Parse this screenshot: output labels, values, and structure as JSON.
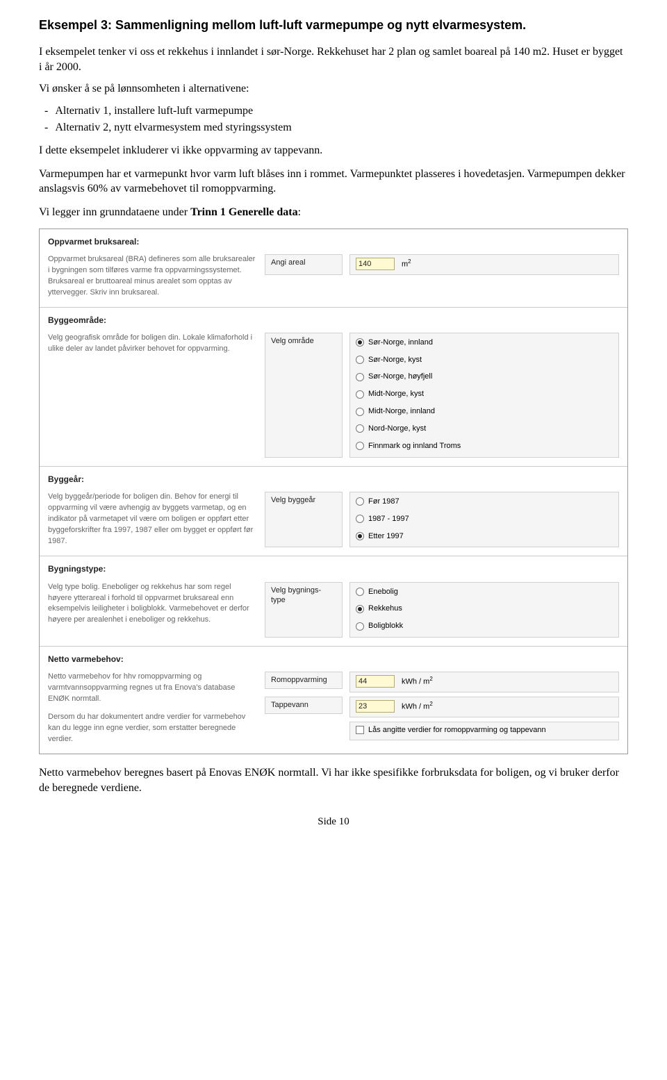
{
  "title": "Eksempel 3: Sammenligning mellom luft-luft varmepumpe og nytt elvarmesystem.",
  "intro1": "I eksempelet tenker vi oss et rekkehus i innlandet i sør-Norge. Rekkehuset har 2 plan og samlet boareal på 140 m2. Huset er bygget i år 2000.",
  "intro2": "Vi ønsker å se på lønnsomheten i alternativene:",
  "alts": [
    "Alternativ 1, installere luft-luft varmepumpe",
    "Alternativ 2, nytt elvarmesystem med styringssystem"
  ],
  "par1": "I dette eksempelet inkluderer vi ikke oppvarming av tappevann.",
  "par2": "Varmepumpen har et varmepunkt hvor varm luft blåses inn i rommet. Varmepunktet plasseres i hovedetasjen. Varmepumpen dekker anslagsvis 60% av varmebehovet til romoppvarming.",
  "par3a": "Vi legger inn grunndataene under ",
  "par3b": "Trinn 1 Generelle data",
  "par3c": ":",
  "grunndata_note": "Netto varmebehov beregnes basert på Enovas ENØK normtall. Vi har ikke spesifikke forbruksdata for boligen, og vi bruker derfor de beregnede verdiene.",
  "footer": "Side 10",
  "form": {
    "bruksareal": {
      "heading": "Oppvarmet bruksareal:",
      "desc": "Oppvarmet bruksareal (BRA) defineres som alle bruksarealer i bygningen som tilføres varme fra oppvarmingssystemet. Bruksareal er bruttoareal minus arealet som opptas av yttervegger. Skriv inn bruksareal.",
      "label": "Angi areal",
      "value": "140",
      "unit_html": "m²"
    },
    "byggeomrade": {
      "heading": "Byggeområde:",
      "desc": "Velg geografisk område for boligen din. Lokale klimaforhold i ulike deler av landet påvirker behovet for oppvarming.",
      "label": "Velg område",
      "options": [
        "Sør-Norge, innland",
        "Sør-Norge, kyst",
        "Sør-Norge, høyfjell",
        "Midt-Norge, kyst",
        "Midt-Norge, innland",
        "Nord-Norge, kyst",
        "Finnmark og innland Troms"
      ],
      "selected": 0
    },
    "byggear": {
      "heading": "Byggeår:",
      "desc": "Velg byggeår/periode for boligen din. Behov for energi til oppvarming vil være avhengig av byggets varmetap, og en indikator på varmetapet vil være om boligen er oppført etter byggeforskrifter fra 1997, 1987 eller om bygget er oppført før 1987.",
      "label": "Velg byggeår",
      "options": [
        "Før 1987",
        "1987 - 1997",
        "Etter 1997"
      ],
      "selected": 2
    },
    "bygningstype": {
      "heading": "Bygningstype:",
      "desc": "Velg type bolig. Eneboliger og rekkehus har som regel høyere ytterareal i forhold til oppvarmet bruksareal enn eksempelvis leiligheter i boligblokk. Varmebehovet er derfor høyere per arealenhet i eneboliger og rekkehus.",
      "label": "Velg bygnings-\ntype",
      "options": [
        "Enebolig",
        "Rekkehus",
        "Boligblokk"
      ],
      "selected": 1
    },
    "varmebehov": {
      "heading": "Netto varmebehov:",
      "desc1": "Netto varmebehov for hhv romoppvarming og varmtvannsoppvarming regnes ut fra Enova's database ENØK normtall.",
      "desc2": "Dersom du har dokumentert andre verdier for varmebehov kan du legge inn egne verdier, som erstatter beregnede verdier.",
      "label_rom": "Romoppvarming",
      "value_rom": "44",
      "label_tappe": "Tappevann",
      "value_tappe": "23",
      "unit": "kWh / m²",
      "lock_label": "Lås angitte verdier for romoppvarming og tappevann"
    }
  }
}
